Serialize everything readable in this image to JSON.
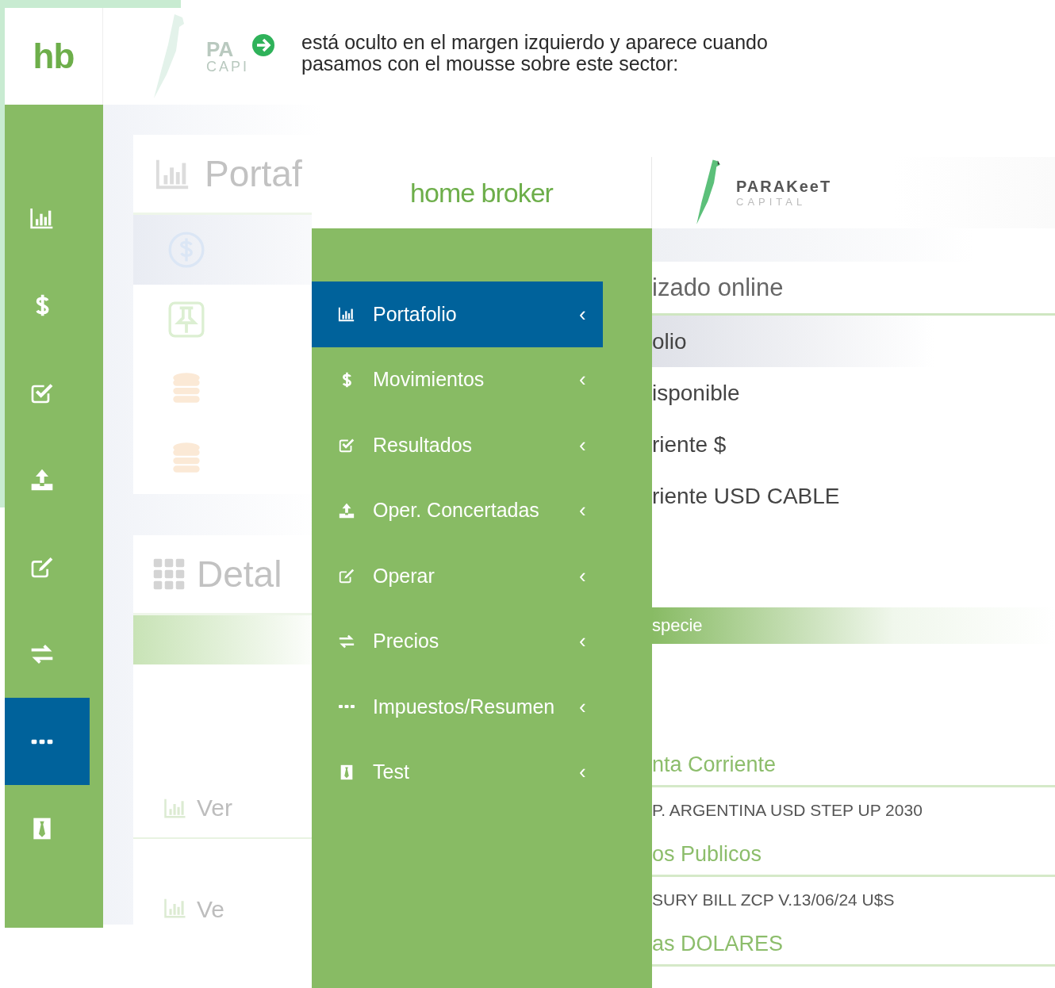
{
  "note": {
    "text": "está oculto en el margen izquierdo y aparece cuando\npasamos con el mousse sobre este sector:"
  },
  "collapsed_app": {
    "logo": "hb",
    "faded_brand": "PA",
    "faded_brand_sub": "CAPI",
    "sidebar": [
      {
        "kind": "chart",
        "selected": false
      },
      {
        "kind": "dollar",
        "selected": false
      },
      {
        "kind": "check",
        "selected": false
      },
      {
        "kind": "upload",
        "selected": false
      },
      {
        "kind": "edit",
        "selected": false
      },
      {
        "kind": "transfer",
        "selected": false
      },
      {
        "kind": "dots",
        "selected": true
      },
      {
        "kind": "tie",
        "selected": false
      }
    ],
    "card_titles": [
      "Portaf",
      "Detal"
    ],
    "lower_rows": [
      "Ver",
      "Ve"
    ]
  },
  "expanded_app": {
    "title": "home broker",
    "brand": "PARAKeeT",
    "brand_sub": "CAPITAL",
    "menu": [
      {
        "kind": "chart",
        "label": "Portafolio",
        "chevron": "‹",
        "selected": true
      },
      {
        "kind": "dollar",
        "label": "Movimientos",
        "chevron": "‹",
        "selected": false
      },
      {
        "kind": "check",
        "label": "Resultados",
        "chevron": "‹",
        "selected": false
      },
      {
        "kind": "upload",
        "label": "Oper. Concertadas",
        "chevron": "‹",
        "selected": false
      },
      {
        "kind": "edit",
        "label": "Operar",
        "chevron": "‹",
        "selected": false
      },
      {
        "kind": "transfer",
        "label": "Precios",
        "chevron": "‹",
        "selected": false
      },
      {
        "kind": "dots",
        "label": "Impuestos/Resumen",
        "chevron": "‹",
        "selected": false
      },
      {
        "kind": "tie",
        "label": "Test",
        "chevron": "‹",
        "selected": false
      }
    ],
    "content": [
      {
        "kind": "heading",
        "text": "izado online"
      },
      {
        "kind": "row",
        "text": "olio",
        "selected": true
      },
      {
        "kind": "row",
        "text": "isponible",
        "selected": false
      },
      {
        "kind": "row",
        "text": "riente $",
        "selected": false
      },
      {
        "kind": "row",
        "text": "riente USD CABLE",
        "selected": false
      },
      {
        "kind": "bar",
        "text": "specie"
      },
      {
        "kind": "group",
        "text": "nta Corriente"
      },
      {
        "kind": "item",
        "text": "P. ARGENTINA USD STEP UP 2030"
      },
      {
        "kind": "group",
        "text": "os Publicos"
      },
      {
        "kind": "item",
        "text": "SURY BILL ZCP V.13/06/24 U$S"
      },
      {
        "kind": "group",
        "text": "as DOLARES"
      }
    ]
  }
}
